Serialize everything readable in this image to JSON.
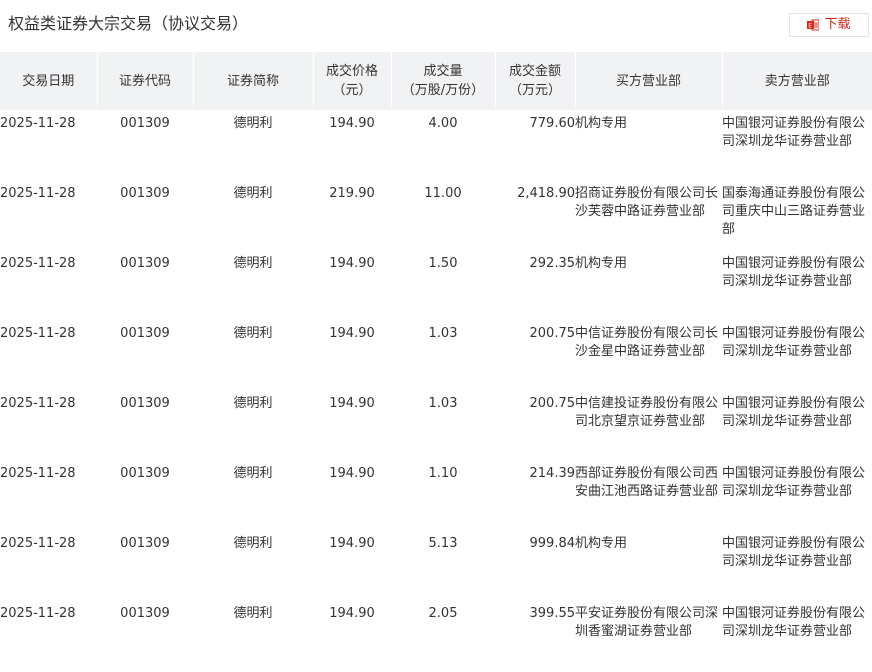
{
  "page": {
    "title": "权益类证券大宗交易（协议交易）"
  },
  "toolbar": {
    "download_label": "下载",
    "download_icon": "excel-file-icon",
    "accent_color": "#d9281b"
  },
  "table": {
    "headers": {
      "date": "交易日期",
      "code": "证券代码",
      "name": "证券简称",
      "price_line1": "成交价格",
      "price_line2": "（元）",
      "volume_line1": "成交量",
      "volume_line2": "（万股/万份）",
      "amount_line1": "成交金额",
      "amount_line2": "（万元）",
      "buyer": "买方营业部",
      "seller": "卖方营业部"
    },
    "header_bg": "#f1f2f4",
    "rows": [
      {
        "date": "2025-11-28",
        "code": "001309",
        "name": "德明利",
        "price": "194.90",
        "volume": "4.00",
        "amount": "779.60",
        "buyer": "机构专用",
        "seller": "中国银河证券股份有限公司深圳龙华证券营业部"
      },
      {
        "date": "2025-11-28",
        "code": "001309",
        "name": "德明利",
        "price": "219.90",
        "volume": "11.00",
        "amount": "2,418.90",
        "buyer": "招商证券股份有限公司长沙芙蓉中路证券营业部",
        "seller": "国泰海通证券股份有限公司重庆中山三路证券营业部"
      },
      {
        "date": "2025-11-28",
        "code": "001309",
        "name": "德明利",
        "price": "194.90",
        "volume": "1.50",
        "amount": "292.35",
        "buyer": "机构专用",
        "seller": "中国银河证券股份有限公司深圳龙华证券营业部"
      },
      {
        "date": "2025-11-28",
        "code": "001309",
        "name": "德明利",
        "price": "194.90",
        "volume": "1.03",
        "amount": "200.75",
        "buyer": "中信证券股份有限公司长沙金星中路证券营业部",
        "seller": "中国银河证券股份有限公司深圳龙华证券营业部"
      },
      {
        "date": "2025-11-28",
        "code": "001309",
        "name": "德明利",
        "price": "194.90",
        "volume": "1.03",
        "amount": "200.75",
        "buyer": "中信建投证券股份有限公司北京望京证券营业部",
        "seller": "中国银河证券股份有限公司深圳龙华证券营业部"
      },
      {
        "date": "2025-11-28",
        "code": "001309",
        "name": "德明利",
        "price": "194.90",
        "volume": "1.10",
        "amount": "214.39",
        "buyer": "西部证券股份有限公司西安曲江池西路证券营业部",
        "seller": "中国银河证券股份有限公司深圳龙华证券营业部"
      },
      {
        "date": "2025-11-28",
        "code": "001309",
        "name": "德明利",
        "price": "194.90",
        "volume": "5.13",
        "amount": "999.84",
        "buyer": "机构专用",
        "seller": "中国银河证券股份有限公司深圳龙华证券营业部"
      },
      {
        "date": "2025-11-28",
        "code": "001309",
        "name": "德明利",
        "price": "194.90",
        "volume": "2.05",
        "amount": "399.55",
        "buyer": "平安证券股份有限公司深圳香蜜湖证券营业部",
        "seller": "中国银河证券股份有限公司深圳龙华证券营业部"
      }
    ]
  }
}
